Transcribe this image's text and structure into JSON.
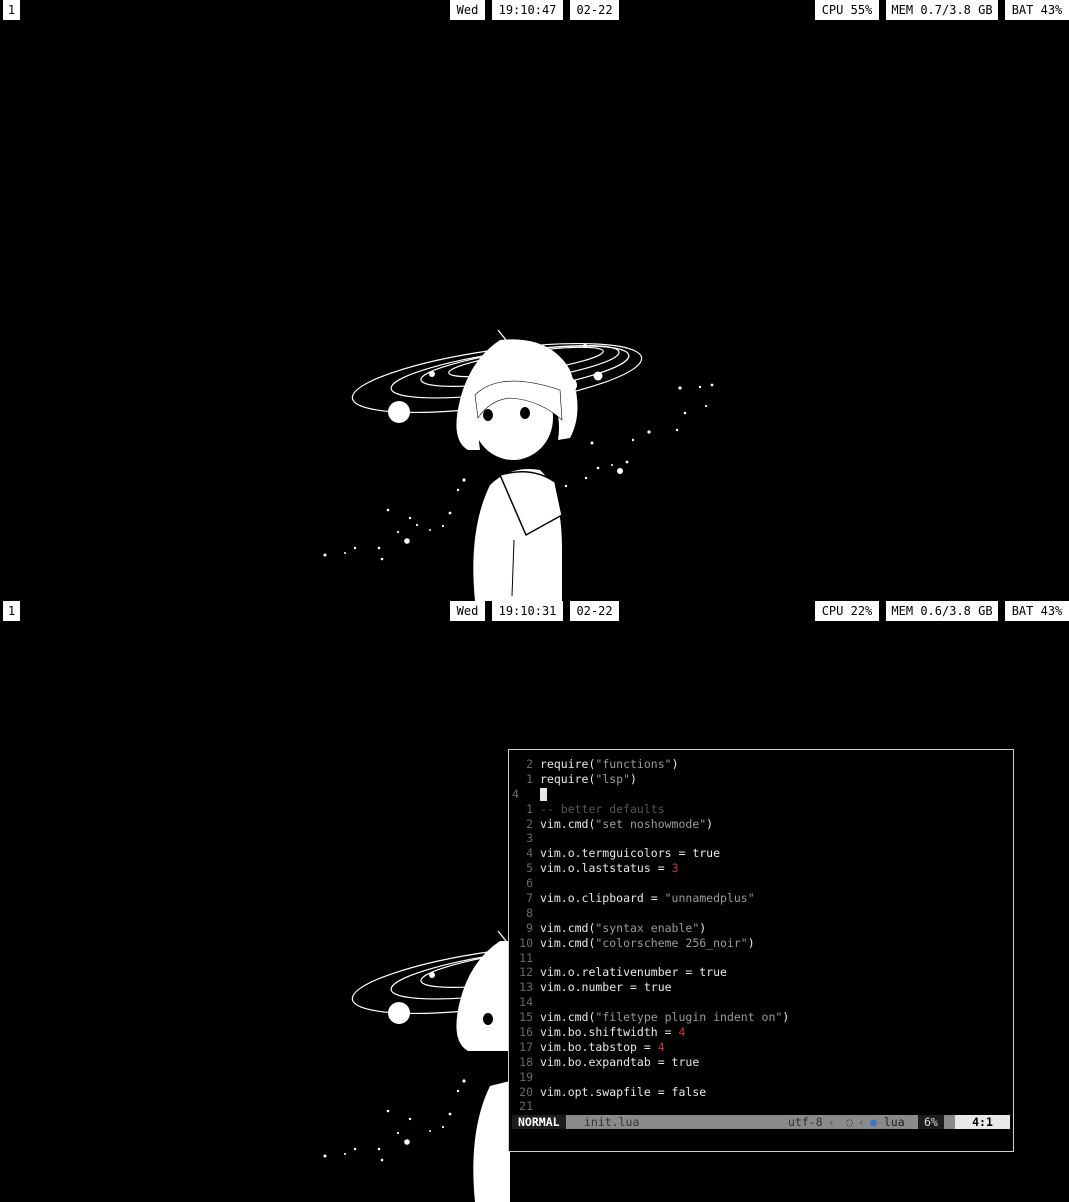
{
  "top_bar": {
    "workspace": "1",
    "day": "Wed",
    "time": "19:10:47",
    "date": "02-22",
    "cpu": "CPU 55%",
    "mem": "MEM 0.7/3.8 GB",
    "bat": "BAT 43%"
  },
  "bottom_bar": {
    "workspace": "1",
    "day": "Wed",
    "time": "19:10:31",
    "date": "02-22",
    "cpu": "CPU 22%",
    "mem": "MEM 0.6/3.8 GB",
    "bat": "BAT 43%"
  },
  "editor": {
    "lines": [
      {
        "num": "2",
        "parts": [
          [
            "t",
            "require("
          ],
          [
            "s",
            "\"functions\""
          ],
          [
            "t",
            ")"
          ]
        ]
      },
      {
        "num": "1",
        "parts": [
          [
            "t",
            "require("
          ],
          [
            "s",
            "\"lsp\""
          ],
          [
            "t",
            ")"
          ]
        ]
      },
      {
        "num": "4",
        "current": true,
        "parts": []
      },
      {
        "num": "1",
        "parts": [
          [
            "c",
            "-- better defaults"
          ]
        ]
      },
      {
        "num": "2",
        "parts": [
          [
            "t",
            "vim.cmd("
          ],
          [
            "s",
            "\"set noshowmode\""
          ],
          [
            "t",
            ")"
          ]
        ]
      },
      {
        "num": "3",
        "parts": []
      },
      {
        "num": "4",
        "parts": [
          [
            "t",
            "vim.o.termguicolors = true"
          ]
        ]
      },
      {
        "num": "5",
        "parts": [
          [
            "t",
            "vim.o.laststatus = "
          ],
          [
            "n",
            "3"
          ]
        ]
      },
      {
        "num": "6",
        "parts": []
      },
      {
        "num": "7",
        "parts": [
          [
            "t",
            "vim.o.clipboard = "
          ],
          [
            "s",
            "\"unnamedplus\""
          ]
        ]
      },
      {
        "num": "8",
        "parts": []
      },
      {
        "num": "9",
        "parts": [
          [
            "t",
            "vim.cmd("
          ],
          [
            "s",
            "\"syntax enable\""
          ],
          [
            "t",
            ")"
          ]
        ]
      },
      {
        "num": "10",
        "parts": [
          [
            "t",
            "vim.cmd("
          ],
          [
            "s",
            "\"colorscheme 256_noir\""
          ],
          [
            "t",
            ")"
          ]
        ]
      },
      {
        "num": "11",
        "parts": []
      },
      {
        "num": "12",
        "parts": [
          [
            "t",
            "vim.o.relativenumber = true"
          ]
        ]
      },
      {
        "num": "13",
        "parts": [
          [
            "t",
            "vim.o.number = true"
          ]
        ]
      },
      {
        "num": "14",
        "parts": []
      },
      {
        "num": "15",
        "parts": [
          [
            "t",
            "vim.cmd("
          ],
          [
            "s",
            "\"filetype plugin indent on\""
          ],
          [
            "t",
            ")"
          ]
        ]
      },
      {
        "num": "16",
        "parts": [
          [
            "t",
            "vim.bo.shiftwidth = "
          ],
          [
            "n",
            "4"
          ]
        ]
      },
      {
        "num": "17",
        "parts": [
          [
            "t",
            "vim.bo.tabstop = "
          ],
          [
            "n",
            "4"
          ]
        ]
      },
      {
        "num": "18",
        "parts": [
          [
            "t",
            "vim.bo.expandtab = true"
          ]
        ]
      },
      {
        "num": "19",
        "parts": []
      },
      {
        "num": "20",
        "parts": [
          [
            "t",
            "vim.opt.swapfile = false"
          ]
        ]
      },
      {
        "num": "21",
        "parts": []
      }
    ],
    "status": {
      "mode": "NORMAL",
      "file": "init.lua",
      "encoding": "utf-8",
      "filetype": "lua",
      "percent": "6%",
      "position": "4:1"
    }
  },
  "colors": {
    "background": "#000000",
    "bar_pill": "#ffffff",
    "number_literal": "#c0392b",
    "filetype_icon": "#3a78c9"
  }
}
